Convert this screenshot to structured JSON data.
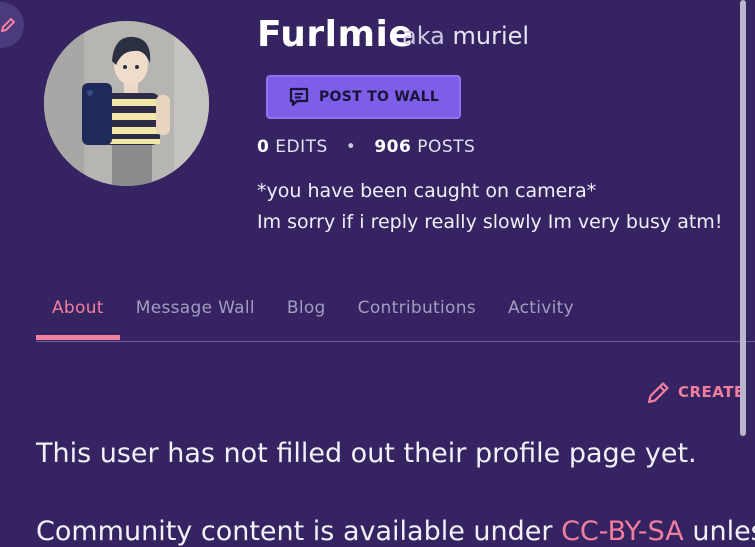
{
  "profile": {
    "username": "Furlmie",
    "aka_word": "aka",
    "aka_name": "muriel",
    "post_button_label": "POST TO WALL",
    "edits_count": "0",
    "edits_label": "EDITS",
    "posts_count": "906",
    "posts_label": "POSTS",
    "bio_line1": "*you have been caught on camera*",
    "bio_line2": "Im sorry if i reply really slowly Im very busy atm!"
  },
  "tabs": [
    {
      "label": "About",
      "active": true
    },
    {
      "label": "Message Wall"
    },
    {
      "label": "Blog"
    },
    {
      "label": "Contributions"
    },
    {
      "label": "Activity"
    }
  ],
  "content": {
    "create_label": "CREATE",
    "empty_message": "This user has not filled out their profile page yet.",
    "footer_prefix": "Community content is available under ",
    "footer_link": "CC-BY-SA",
    "footer_suffix": " unless"
  },
  "icons": {
    "edit": "pencil-icon",
    "post": "message-icon",
    "create": "pencil-icon"
  },
  "colors": {
    "background": "#362462",
    "accent": "#f27fa0",
    "button": "#7d5ee8"
  }
}
